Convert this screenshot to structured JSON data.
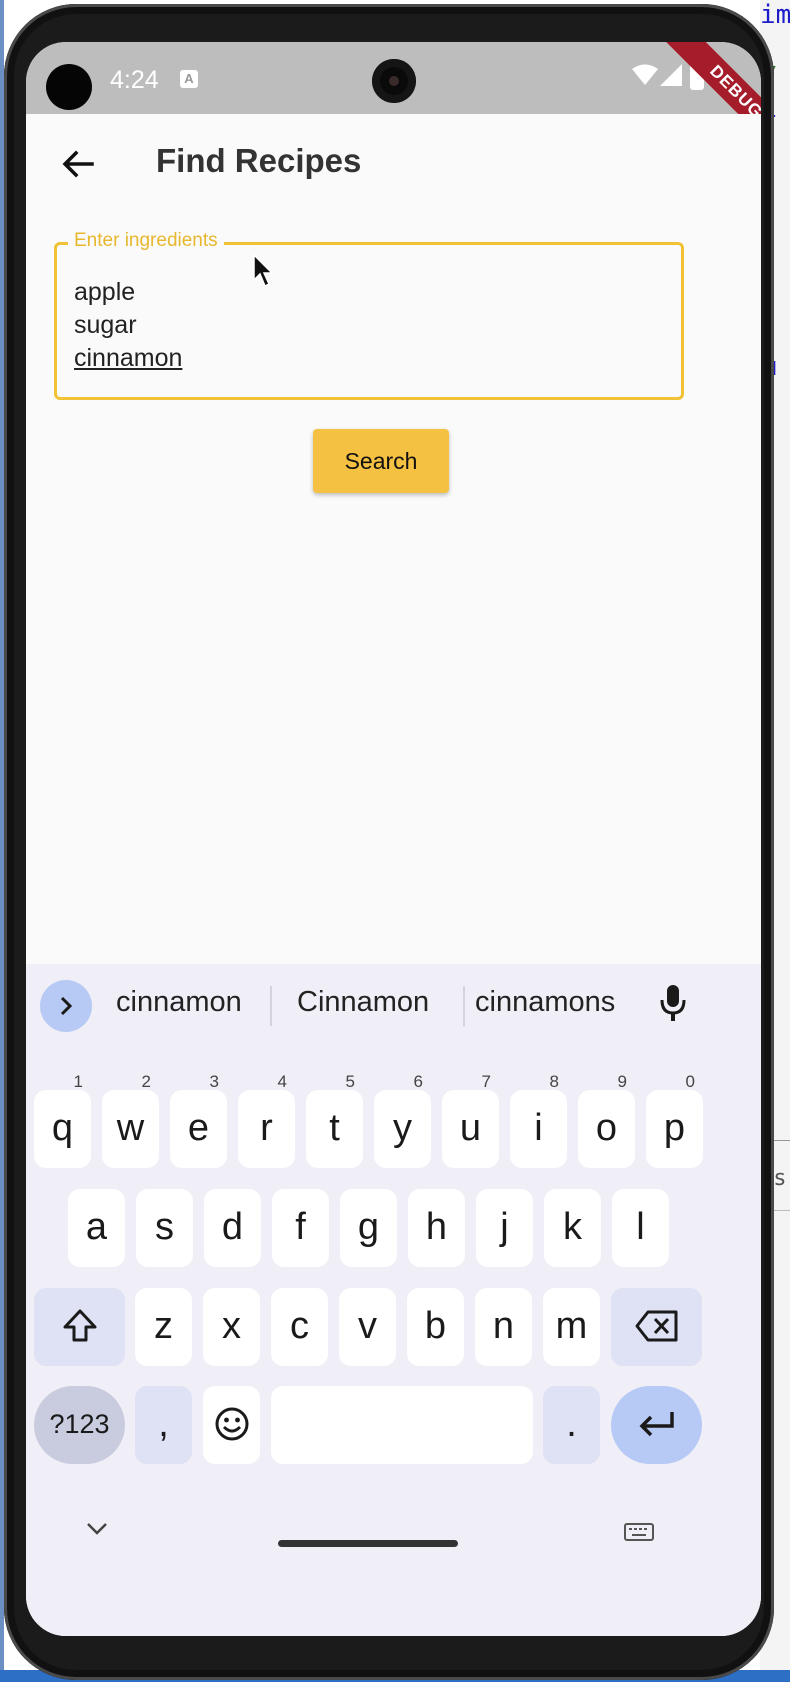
{
  "status_bar": {
    "time": "4:24",
    "debug_label": "DEBUG"
  },
  "app_bar": {
    "title": "Find Recipes"
  },
  "ingredients_field": {
    "label": "Enter ingredients",
    "lines": [
      "apple",
      "sugar",
      "cinnamon"
    ]
  },
  "search_button": {
    "label": "Search"
  },
  "keyboard": {
    "suggestions": [
      "cinnamon",
      "Cinnamon",
      "cinnamons"
    ],
    "row1": [
      {
        "key": "q",
        "hint": "1"
      },
      {
        "key": "w",
        "hint": "2"
      },
      {
        "key": "e",
        "hint": "3"
      },
      {
        "key": "r",
        "hint": "4"
      },
      {
        "key": "t",
        "hint": "5"
      },
      {
        "key": "y",
        "hint": "6"
      },
      {
        "key": "u",
        "hint": "7"
      },
      {
        "key": "i",
        "hint": "8"
      },
      {
        "key": "o",
        "hint": "9"
      },
      {
        "key": "p",
        "hint": "0"
      }
    ],
    "row2": [
      "a",
      "s",
      "d",
      "f",
      "g",
      "h",
      "j",
      "k",
      "l"
    ],
    "row3": [
      "z",
      "x",
      "c",
      "v",
      "b",
      "n",
      "m"
    ],
    "symbols_label": "?123",
    "comma_label": ",",
    "period_label": "."
  },
  "ide_fragments": [
    "im",
    "/",
    "l",
    "u",
    "us",
    "e"
  ]
}
